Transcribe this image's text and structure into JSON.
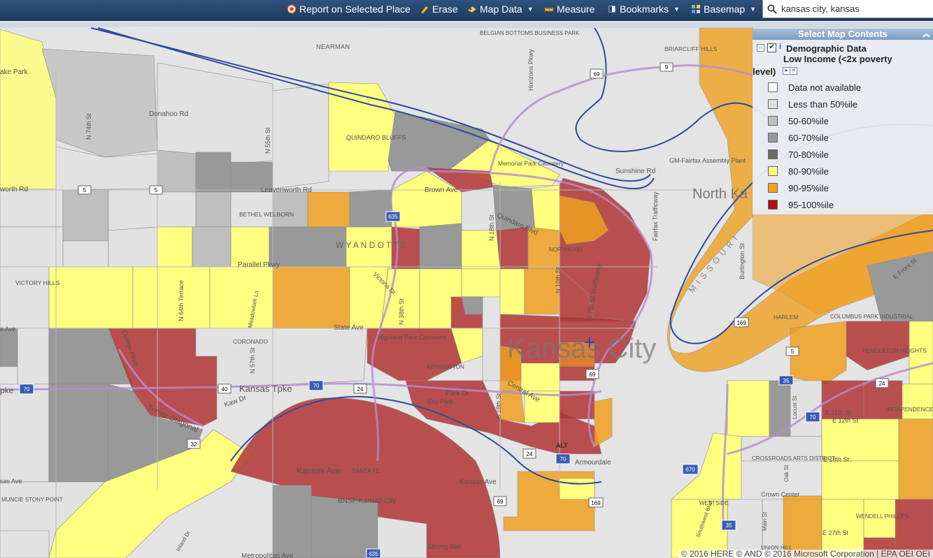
{
  "toolbar": {
    "report_label": "Report on Selected Place",
    "erase_label": "Erase",
    "map_data_label": "Map Data",
    "measure_label": "Measure",
    "bookmarks_label": "Bookmarks",
    "basemap_label": "Basemap"
  },
  "search": {
    "value": "kansas city, kansas"
  },
  "panel": {
    "title": "Select Map Contents",
    "layer_group": "Demographic Data",
    "layer_name_line1": "Low Income (<2x poverty",
    "layer_name_line2": "level)",
    "legend": [
      {
        "label": "Data not available",
        "color": "#ffffff"
      },
      {
        "label": "Less than 50%ile",
        "color": "#e0e0e0"
      },
      {
        "label": "50-60%ile",
        "color": "#bfbfbf"
      },
      {
        "label": "60-70%ile",
        "color": "#999999"
      },
      {
        "label": "70-80%ile",
        "color": "#6e6a62"
      },
      {
        "label": "80-90%ile",
        "color": "#ffff80"
      },
      {
        "label": "90-95%ile",
        "color": "#f0a020"
      },
      {
        "label": "95-100%ile",
        "color": "#b01010"
      }
    ]
  },
  "map": {
    "labels": {
      "nearman": "NEARMAN",
      "donahoo": "Donahoo Rd",
      "quindaro_bluffs": "QUINDARO BLUFFS",
      "memorial_park": "Memorial Park Cemetery",
      "belgian_bottoms": "BELGIAN BOTTOMS BUSINESS PARK",
      "briarcliff": "BRIARCLIFF HILLS",
      "sunshine": "Sunshine Rd",
      "gm_fairfax": "GM-Fairfax Assembly Plant",
      "north_kc": "North Ka",
      "leavenworth": "Leavenworth Rd",
      "bethel": "BETHEL WELBORN",
      "brown_ave": "Brown Ave",
      "quindaro_blvd": "Quindaro Blvd",
      "wyandotte": "W Y A N D O T T E",
      "northeast": "NORTHEAST",
      "parallel_pkwy": "Parallel Pkwy",
      "victory_hills": "VICTORY HILLS",
      "state_ave": "State Ave",
      "coronado": "CORONADO",
      "highland_park": "Highland Park Cemetery",
      "kensington": "KENSINGTON",
      "kansas_city_big": "Kansas City",
      "kansas_tpke": "Kansas Tpke",
      "kaw_dr": "Kaw Dr",
      "turner_diagonal": "Turner Diagonal",
      "city_park": "City Park",
      "park_dr": "Park Dr",
      "central_ave": "Central Ave",
      "kansas_ave": "Kansas Ave",
      "kansas_ave2": "Kansas Ave",
      "santa_fe": "SANTA FE",
      "bnsf": "BNSF-Kansas City",
      "strong_ave": "Strong Ave",
      "metropolitan": "Metropolitan Ave",
      "muncie": "MUNCIE STONY POINT",
      "armourdale": "Armourdale",
      "harlem": "HARLEM",
      "columbus_park": "COLUMBUS PARK INDUSTRIAL",
      "pendleton": "PENDLETON HEIGHTS",
      "independence_plaza": "INDEPENDENCE PLAZA",
      "crossroads": "CROSSROADS ARTS DISTRICT",
      "westside": "WESTSIDE",
      "crown_center": "Crown Center",
      "wendell": "WENDELL PHILLIPS",
      "union_hill": "UNION HILL",
      "e_11th": "E 11th St",
      "e_12th": "E 12th St",
      "e_18th": "E 18th St",
      "e_27th": "E 27th St",
      "burlington": "Burlington St",
      "fairfax_tfwy": "Fairfax Trafficway",
      "n7th": "N 7th St Trafficway",
      "horizons": "Horizons Pkwy",
      "victoria": "Victoria Dr",
      "college_pkwy": "College Pkwy",
      "alt": "ALT",
      "missouri": "MISSOURI",
      "e_front": "E Front St",
      "main_st": "Main St",
      "oak_st": "Oak St",
      "locust": "Locust St",
      "southwest_blvd": "Southwest Blvd",
      "inland_dr": "Inland Dr",
      "n_74th": "N 74th St",
      "n_55th": "N 55th St",
      "n_64th": "N 64th Terrace",
      "n_38th": "N 38th St",
      "n_18th": "N 18th St",
      "n_10th": "N 10th St",
      "s_18th": "S 18th St",
      "meadowlark": "Meadowlark Ln",
      "n_57th": "N 57th St",
      "lake_park": "ake Park",
      "worth_rd": "worth Rd",
      "pke": "pke",
      "sas_ave": "sas Ave",
      "e_ave": "e Ave"
    },
    "shields": [
      "5",
      "5",
      "635",
      "9",
      "69",
      "169",
      "70",
      "40",
      "70",
      "24",
      "24",
      "69",
      "32",
      "70",
      "169",
      "69",
      "35",
      "670",
      "70",
      "24",
      "635",
      "5",
      "35"
    ]
  },
  "copyright": "© 2016 HERE  © AND  © 2016 Microsoft Corporation | EPA OEI OEI"
}
